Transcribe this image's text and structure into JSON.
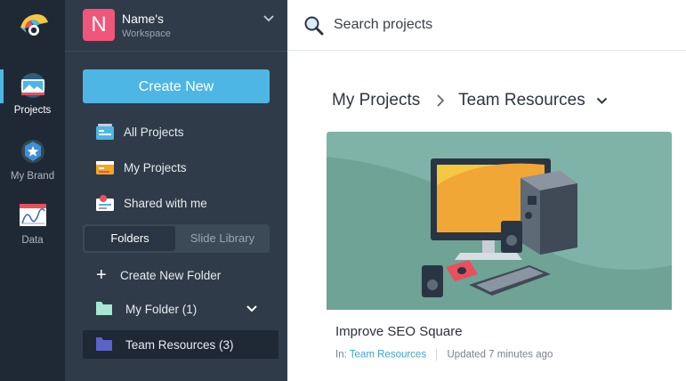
{
  "rail": {
    "items": [
      {
        "label": "Projects"
      },
      {
        "label": "My Brand"
      },
      {
        "label": "Data"
      }
    ]
  },
  "workspace": {
    "initial": "N",
    "name": "Name's",
    "subtitle": "Workspace"
  },
  "sidebar": {
    "create_label": "Create New",
    "nav": [
      {
        "label": "All Projects",
        "icon": "all-projects-icon"
      },
      {
        "label": "My Projects",
        "icon": "my-projects-icon"
      },
      {
        "label": "Shared with me",
        "icon": "shared-icon"
      }
    ],
    "segment": {
      "folders": "Folders",
      "slide_library": "Slide Library"
    },
    "create_folder_label": "Create New Folder",
    "folders": [
      {
        "label": "My Folder (1)",
        "color": "#a7e6cf"
      },
      {
        "label": "Team Resources (3)",
        "color": "#5b63c9"
      }
    ]
  },
  "search": {
    "placeholder": "Search projects"
  },
  "breadcrumb": {
    "root": "My Projects",
    "current": "Team Resources"
  },
  "project": {
    "title": "Improve SEO Square",
    "in_label": "In:",
    "folder": "Team Resources",
    "updated": "Updated 7 minutes ago"
  },
  "colors": {
    "accent": "#4db6e4",
    "sidebar": "#2f3b49",
    "rail": "#1f2935",
    "thumb_bg": "#7fb3a8"
  }
}
